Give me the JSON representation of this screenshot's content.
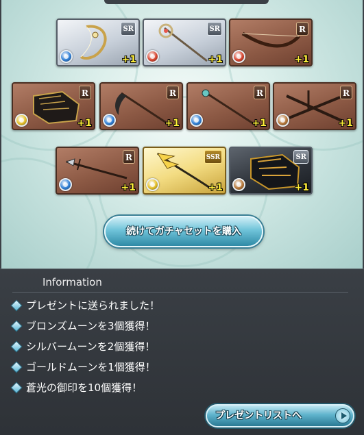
{
  "cards": [
    {
      "rarity": "SR",
      "element": "water",
      "element_color": "#2f7fd6",
      "weapon": "bow-icon",
      "plus": "+1"
    },
    {
      "rarity": "SR",
      "element": "fire",
      "element_color": "#d8452f",
      "weapon": "staff-icon",
      "plus": "+1"
    },
    {
      "rarity": "R",
      "element": "fire",
      "element_color": "#d8452f",
      "weapon": "bow-icon",
      "plus": "+1"
    },
    {
      "rarity": "R",
      "element": "light",
      "element_color": "#e6c12a",
      "weapon": "gauntlet-icon",
      "plus": "+1"
    },
    {
      "rarity": "R",
      "element": "water",
      "element_color": "#2f7fd6",
      "weapon": "scythe-icon",
      "plus": "+1"
    },
    {
      "rarity": "R",
      "element": "water",
      "element_color": "#2f7fd6",
      "weapon": "staff-icon",
      "plus": "+1"
    },
    {
      "rarity": "R",
      "element": "earth",
      "element_color": "#b7783a",
      "weapon": "swords-icon",
      "plus": "+1"
    },
    {
      "rarity": "R",
      "element": "water",
      "element_color": "#2f7fd6",
      "weapon": "spear-icon",
      "plus": "+1"
    },
    {
      "rarity": "SSR",
      "element": "light",
      "element_color": "#e6c12a",
      "weapon": "spear-icon",
      "plus": "+1"
    },
    {
      "rarity": "SR",
      "element": "earth",
      "element_color": "#b7783a",
      "weapon": "gauntlet-icon",
      "plus": "+1"
    }
  ],
  "buy_button": "続けてガチャセットを購入",
  "info": {
    "title": "Information",
    "lines": [
      "プレゼントに送られました！",
      "ブロンズムーンを3個獲得！",
      "シルバームーンを2個獲得！",
      "ゴールドムーンを1個獲得！",
      "蒼光の御印を10個獲得！"
    ]
  },
  "present_button": "プレゼントリストへ"
}
